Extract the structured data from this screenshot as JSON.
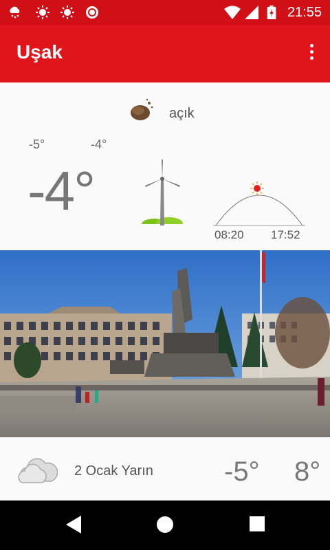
{
  "status_bar": {
    "time": "21:55",
    "icons": [
      "snow-cloud-icon",
      "sun-icon",
      "sun-icon",
      "record-icon",
      "wifi-icon",
      "signal-icon",
      "battery-charging-icon"
    ]
  },
  "app_bar": {
    "title": "Uşak",
    "overflow_icon": "more-vert-icon"
  },
  "current": {
    "condition": "açık",
    "temp_min": "-5°",
    "temp_max": "-4°",
    "temperature": "-4°",
    "sunrise": "08:20",
    "sunset": "17:52",
    "icon": "clear-night-icon"
  },
  "forecast": {
    "date": "2 Ocak Yarın",
    "min": "-5°",
    "max": "8°",
    "icon": "cloudy-icon"
  },
  "nav_bar": {
    "icons": [
      "back-icon",
      "home-icon",
      "recent-apps-icon"
    ]
  },
  "colors": {
    "primary": "#e0141b",
    "primary_dark": "#d10f16"
  }
}
